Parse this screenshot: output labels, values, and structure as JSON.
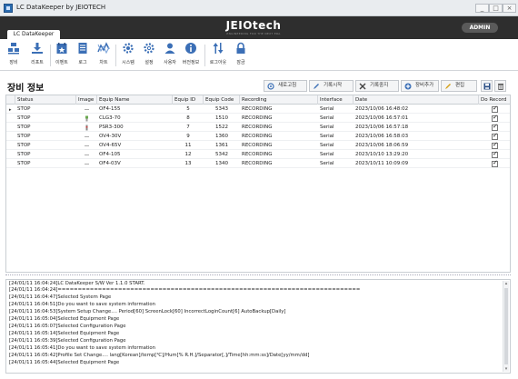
{
  "window": {
    "title": "LC DataKeeper by JEIOTECH",
    "controls": [
      "_",
      "□",
      "×"
    ]
  },
  "ribbon": {
    "tab_label": "LC DataKeeper",
    "brand": "JEIOtech",
    "brand_sub": "ENGINEERING FOR THE NEXT ERA",
    "user_badge": "ADMIN",
    "tools": [
      {
        "label": "장비",
        "icon": "equipment-icon"
      },
      {
        "label": "리포트",
        "icon": "download-report-icon"
      },
      {
        "label": "이벤트",
        "icon": "event-icon"
      },
      {
        "label": "로그",
        "icon": "log-icon"
      },
      {
        "label": "차트",
        "icon": "chart-icon"
      },
      {
        "label": "시스템",
        "icon": "system-gear-icon"
      },
      {
        "label": "설정",
        "icon": "settings-gear-icon"
      },
      {
        "label": "사용자",
        "icon": "user-icon"
      },
      {
        "label": "버전정보",
        "icon": "info-icon"
      },
      {
        "label": "로그아웃",
        "icon": "logout-icon"
      },
      {
        "label": "잠금",
        "icon": "lock-icon"
      }
    ]
  },
  "equipment": {
    "section_title": "장비 정보",
    "actions": {
      "refresh": "새로고침",
      "record_start": "기록시작",
      "record_stop": "기록중지",
      "add_equipment": "장비추가",
      "edit": "편집"
    },
    "columns": [
      "Status",
      "Image",
      "Equip Name",
      "Equip ID",
      "Equip Code",
      "Recording",
      "Interface",
      "Date",
      "Do Record"
    ],
    "rows": [
      {
        "status": "STOP",
        "image": "line",
        "name": "OF4-155",
        "id": "5",
        "code": "5343",
        "recording": "RECORDING",
        "interface": "Serial",
        "date": "2023/10/06 16:48:02"
      },
      {
        "status": "STOP",
        "image": "device-green",
        "name": "CLG3-70",
        "id": "8",
        "code": "1510",
        "recording": "RECORDING",
        "interface": "Serial",
        "date": "2023/10/06 16:57:01"
      },
      {
        "status": "STOP",
        "image": "device-red",
        "name": "PSR3-300",
        "id": "7",
        "code": "1522",
        "recording": "RECORDING",
        "interface": "Serial",
        "date": "2023/10/06 16:57:18"
      },
      {
        "status": "STOP",
        "image": "line",
        "name": "OV4-30V",
        "id": "9",
        "code": "1360",
        "recording": "RECORDING",
        "interface": "Serial",
        "date": "2023/10/06 16:58:03"
      },
      {
        "status": "STOP",
        "image": "line",
        "name": "OV4-65V",
        "id": "11",
        "code": "1361",
        "recording": "RECORDING",
        "interface": "Serial",
        "date": "2023/10/06 18:06:59"
      },
      {
        "status": "STOP",
        "image": "line",
        "name": "OF4-105",
        "id": "12",
        "code": "5342",
        "recording": "RECORDING",
        "interface": "Serial",
        "date": "2023/10/10 13:29:20"
      },
      {
        "status": "STOP",
        "image": "line",
        "name": "OF4-03V",
        "id": "13",
        "code": "1340",
        "recording": "RECORDING",
        "interface": "Serial",
        "date": "2023/10/11 10:09:09"
      }
    ]
  },
  "log": {
    "lines": [
      "[24/01/11 16:04:24]LC DataKeeper S/W Ver 1.1.0 START.",
      "[24/01/11 16:04:24]===========================================================================",
      "[24/01/11 16:04:47]Selected System Page",
      "[24/01/11 16:04:51]Do you want to save system information",
      "[24/01/11 16:04:53]System Setup Change.... Period[60] ScreenLock[60] IncorrectLoginCount[6] AutoBackup[Daily]",
      "[24/01/11 16:05:04]Selected Equipment Page",
      "[24/01/11 16:05:07]Selected Configuration Page",
      "[24/01/11 16:05:14]Selected Equipment Page",
      "[24/01/11 16:05:39]Selected Configuration Page",
      "[24/01/11 16:05:41]Do you want to save system information",
      "[24/01/11 16:05:42]Profile Set Change.... lang[Korean]/temp[℃]/Hum[% R.H.]/Separator[,]/Time[hh:mm:ss]/Date[yy/mm/dd]",
      "[24/01/11 16:05:44]Selected Equipment Page"
    ]
  },
  "colors": {
    "ribbon_bg": "#2e2e2e",
    "accent_blue": "#3b6fb6",
    "titlebar_bg": "#e9ecef"
  }
}
